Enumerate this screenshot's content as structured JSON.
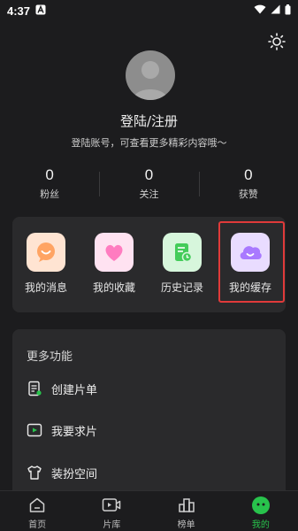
{
  "status_bar": {
    "time": "4:37",
    "notification_icon": "a-icon",
    "wifi_icon": "wifi-icon",
    "signal_icon": "signal-icon",
    "battery_icon": "battery-icon"
  },
  "header": {
    "settings_icon": "sun-icon"
  },
  "profile": {
    "login_title": "登陆/注册",
    "login_subtitle": "登陆账号，可查看更多精彩内容哦～"
  },
  "stats": [
    {
      "value": "0",
      "label": "粉丝"
    },
    {
      "value": "0",
      "label": "关注"
    },
    {
      "value": "0",
      "label": "获赞"
    }
  ],
  "shortcuts": [
    {
      "label": "我的消息",
      "icon": "message-icon",
      "color": "#ffb07a"
    },
    {
      "label": "我的收藏",
      "icon": "heart-icon",
      "color": "#ff86c8"
    },
    {
      "label": "历史记录",
      "icon": "history-icon",
      "color": "#5fd76e"
    },
    {
      "label": "我的缓存",
      "icon": "cloud-icon",
      "color": "#b98cff"
    }
  ],
  "more": {
    "title": "更多功能",
    "items": [
      {
        "label": "创建片单",
        "icon": "create-list-icon"
      },
      {
        "label": "我要求片",
        "icon": "request-video-icon"
      },
      {
        "label": "装扮空间",
        "icon": "shirt-icon"
      }
    ]
  },
  "bottom_nav": [
    {
      "label": "首页",
      "icon": "home-icon"
    },
    {
      "label": "片库",
      "icon": "video-library-icon"
    },
    {
      "label": "榜单",
      "icon": "ranking-icon"
    },
    {
      "label": "我的",
      "icon": "profile-icon",
      "active": true
    }
  ],
  "colors": {
    "background": "#1c1c1e",
    "card": "#2a2a2c",
    "accent_green": "#28c34c",
    "highlight_red": "#e03a3a"
  }
}
